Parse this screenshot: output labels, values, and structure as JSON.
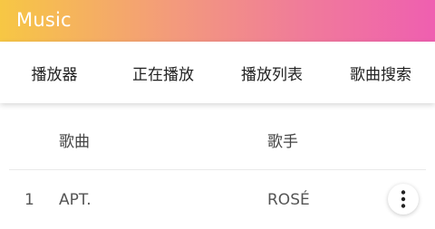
{
  "header": {
    "app_title": "Music",
    "gradient_colors": [
      "#f7c744",
      "#f39a7c",
      "#f07b9a",
      "#ef5fb0"
    ]
  },
  "tabs": [
    {
      "label": "播放器"
    },
    {
      "label": "正在播放"
    },
    {
      "label": "播放列表"
    },
    {
      "label": "歌曲搜索"
    }
  ],
  "table": {
    "columns": {
      "song": "歌曲",
      "artist": "歌手"
    },
    "rows": [
      {
        "index": "1",
        "song": "APT.",
        "artist": "ROSÉ",
        "action_icon": "more-vertical-icon"
      }
    ]
  }
}
